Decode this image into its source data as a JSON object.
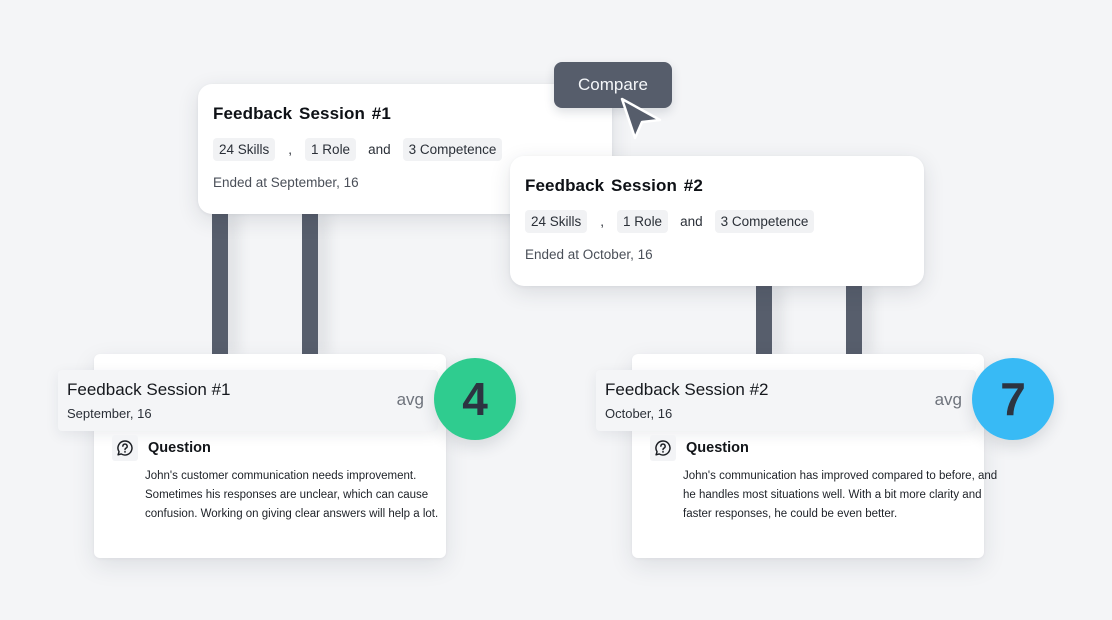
{
  "colors": {
    "background": "#f4f5f7",
    "pillar": "#575e6c",
    "compare_button": "#565d6b",
    "score_low": "#2fcc8f",
    "score_high": "#38baf5",
    "score_text": "#2c3441"
  },
  "compare_button": {
    "label": "Compare",
    "icon": "cursor-arrow-icon"
  },
  "sessions": [
    {
      "title": "Feedback Session  #1",
      "chips": {
        "skills": "24 Skills",
        "comma": ",",
        "role": "1 Role",
        "and": "and",
        "competence": "3 Competence"
      },
      "ended": "Ended at September, 16"
    },
    {
      "title": "Feedback Session  #2",
      "chips": {
        "skills": "24 Skills",
        "comma": ",",
        "role": "1 Role",
        "and": "and",
        "competence": "3 Competence"
      },
      "ended": "Ended at October, 16"
    }
  ],
  "results": [
    {
      "title": "Feedback Session #1",
      "date": "September, 16",
      "avg_label": "avg",
      "score": "4",
      "question_label": "Question",
      "question_icon": "question-chat-icon",
      "text": "John's customer communication needs improvement. Sometimes his responses are unclear, which can cause confusion. Working on giving clear answers will help a lot."
    },
    {
      "title": "Feedback Session #2",
      "date": "October, 16",
      "avg_label": "avg",
      "score": "7",
      "question_label": "Question",
      "question_icon": "question-chat-icon",
      "text": "John's communication has improved compared to before, and he handles most situations well. With a bit more clarity and faster responses, he could be even better."
    }
  ]
}
